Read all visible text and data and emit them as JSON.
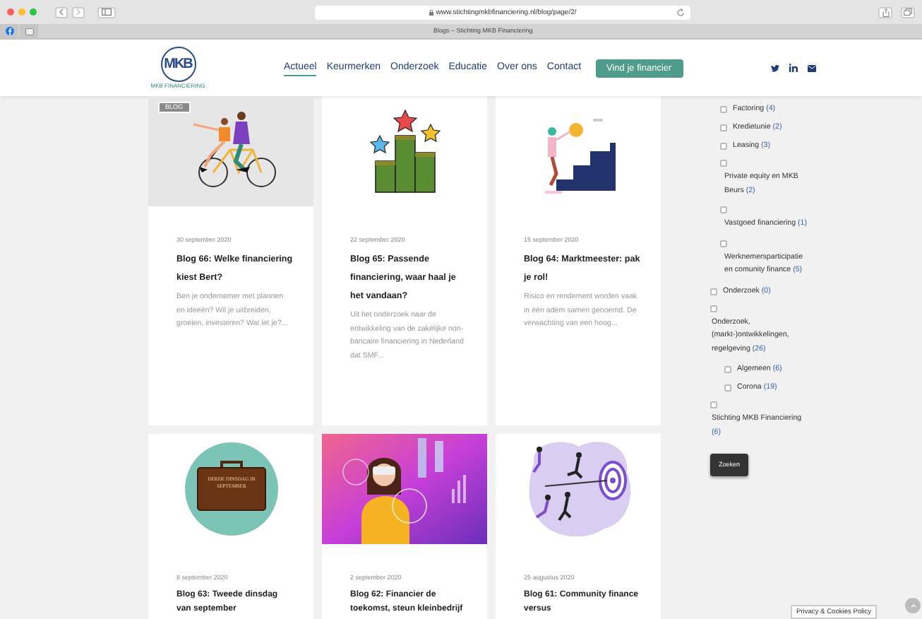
{
  "browser": {
    "url": "www.stichtingmkbfinanciering.nl/blog/page/2/",
    "tab_title": "Blogs – Stichting MKB Financiering"
  },
  "header": {
    "logo": {
      "initials": "MKB",
      "caption": "MKB FINANCIERING"
    },
    "nav": [
      {
        "label": "Actueel",
        "selected": true
      },
      {
        "label": "Keurmerken",
        "selected": false
      },
      {
        "label": "Onderzoek",
        "selected": false
      },
      {
        "label": "Educatie",
        "selected": false
      },
      {
        "label": "Over ons",
        "selected": false
      },
      {
        "label": "Contact",
        "selected": false
      }
    ],
    "cta": "Vind je financier"
  },
  "posts": [
    {
      "badge": "BLOG",
      "date": "30 september 2020",
      "title": "Blog 66: Welke financiering kiest Bert?",
      "excerpt": "Ben je ondernemer met plannen en ideeën? Wil je uitbreiden, groeien, investeren? Wat let je?..."
    },
    {
      "date": "22 september 2020",
      "title": "Blog 65: Passende financiering, waar haal je het vandaan?",
      "excerpt": "Uit het onderzoek naar de entwikkeling van de zakelijke non-bancaire financiering in Nederland dat SMF..."
    },
    {
      "date": "15 september 2020",
      "title": "Blog 64: Marktmeester: pak je rol!",
      "excerpt": "Risico en rendement worden vaak in één adem samen genoemd. De verwachting van een hoog..."
    },
    {
      "image_text": "DERDE DINSDAG IN SEPTEMBER",
      "date": "8 september 2020",
      "title": "Blog 63: Tweede dinsdag van september"
    },
    {
      "date": "2 september 2020",
      "title": "Blog 62: Financier de toekomst, steun kleinbedrijf"
    },
    {
      "date": "25 augustus 2020",
      "title": "Blog 61: Community finance versus"
    }
  ],
  "categories": [
    {
      "children": [
        {
          "label": "Factoring",
          "count": "(4)",
          "checked": false,
          "kind": "inline"
        },
        {
          "label": "Kredietunie",
          "count": "(2)",
          "checked": false,
          "kind": "inline"
        },
        {
          "label": "Leasing",
          "count": "(3)",
          "checked": false,
          "kind": "inline"
        },
        {
          "label": "Private equity en MKB Beurs",
          "count": "(2)",
          "checked": false,
          "kind": "stacked"
        },
        {
          "label": "Vastgoed financiering",
          "count": "(1)",
          "checked": false,
          "kind": "stacked"
        },
        {
          "label": "Werknemersparticipatie en comunity finance",
          "count": "(5)",
          "checked": false,
          "kind": "stacked"
        }
      ]
    },
    {
      "label": "Onderzoek",
      "count": "(0)",
      "checked": false,
      "kind": "inline"
    },
    {
      "label": "Onderzoek, (markt-)ontwikkelingen, regelgeving",
      "count": "(26)",
      "checked": false,
      "kind": "stacked",
      "children": [
        {
          "label": "Algemeen",
          "count": "(6)",
          "checked": false,
          "kind": "inline"
        },
        {
          "label": "Corona",
          "count": "(19)",
          "checked": false,
          "kind": "inline"
        }
      ]
    },
    {
      "label": "Stichting MKB Financiering",
      "count": "(6)",
      "checked": false,
      "kind": "stacked"
    }
  ],
  "search_button": "Zoeken",
  "cookie_notice": "Privacy & Cookies Policy"
}
